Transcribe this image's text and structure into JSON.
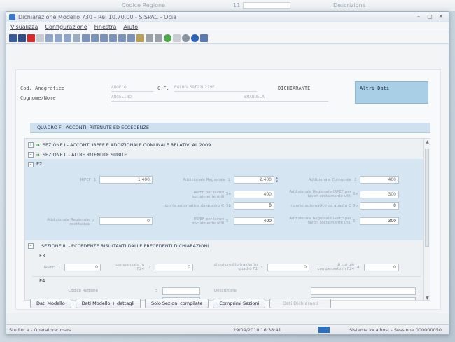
{
  "ghost": {
    "codice_regione": "Codice Regione",
    "num": "11",
    "descrizione": "Descrizione"
  },
  "window": {
    "title": "Dichiarazione Modello 730 - Rel 10.70.00 - SISPAC - Ocia",
    "controls": [
      "–",
      "▢",
      "✕"
    ]
  },
  "menu": [
    "Visualizza",
    "Configurazione",
    "Finestra",
    "Aiuto"
  ],
  "toolbar_icons": [
    "save-icon",
    "delete-icon",
    "new-icon",
    "user-icon",
    "user-icon",
    "user-icon",
    "arrow-icon",
    "grid-icon",
    "grid-icon",
    "grid-icon",
    "grid-icon",
    "grid-icon",
    "grid-icon",
    "sigma-icon",
    "text-icon",
    "settings-icon",
    "green-dot-icon",
    "gray-icon",
    "gear-icon",
    "info-icon",
    "window-icon"
  ],
  "anagrafica": {
    "cod_label": "Cod. Anagrafico",
    "cod_value": "ANGELO",
    "cf_label": "C.F.",
    "cf_value": "RGLNGL59T23L219E",
    "dichiarante": "DICHIARANTE",
    "cognome_label": "Cognome/Nome",
    "cognome_value": "ANGELINO",
    "nome_value": "EMANUELA",
    "altri_dati": "Altri Dati"
  },
  "quadro_title": "QUADRO F - ACCONTI, RITENUTE ED ECCEDENZE",
  "sections": {
    "s1": {
      "toggle": "+",
      "label": "SEZIONE I - ACCONTI IRPEF E ADDIZIONALE COMUNALE RELATIVI AL 2009"
    },
    "s2": {
      "toggle": "–",
      "label": "SEZIONE II - ALTRE RITENUTE SUBITE"
    },
    "s3": {
      "toggle": "–",
      "label": "SEZIONE III - ECCEDENZE RISULTANTI DALLE PRECEDENTI DICHIARAZIONI"
    }
  },
  "f2": {
    "header": "F2",
    "irpef_label": "IRPEF",
    "irpef_num": "1",
    "irpef_val": "1.400",
    "addreg_label": "Addizionale Regionale",
    "addreg_num": "2",
    "addreg_val": "2.400",
    "addcom_label": "Addizionale Comunale",
    "addcom_num": "3",
    "addcom_val": "400",
    "irpef_lav_label": "IRPEF per lavori socialmente utili",
    "irpef_lav_num": "5a",
    "irpef_lav_val": "400",
    "addreg_lav_label": "Addizionale Regionale IRPEF per lavori socialmente utili",
    "addreg_lav_num": "6a",
    "addreg_lav_val": "300",
    "rip_c_label": "riporto automatico da quadro C",
    "rip_c_num": "5b",
    "rip_c_val": "0",
    "rip_c2_label": "riporto automatico da quadro C",
    "rip_c2_num": "6b",
    "rip_c2_val": "0",
    "addreg_ded_label": "Addizionale Regionale sostitutiva",
    "addreg_ded_num": "4",
    "addreg_ded_val": "0",
    "irpef_lav2_label": "IRPEF per lavori socialmente utili",
    "irpef_lav2_num": "5",
    "irpef_lav2_val": "400",
    "addreg_lav2_label": "Addizionale Regionale IRPEF per lavori socialmente utili",
    "addreg_lav2_num": "6",
    "addreg_lav2_val": "300"
  },
  "f3": {
    "header": "F3",
    "irpef_label": "IRPEF",
    "irpef_num": "1",
    "irpef_val": "0",
    "comp_label": "compensato in F24",
    "comp_num": "2",
    "comp_val": "0",
    "credito_label": "di cui credito trasferito quadro F1",
    "credito_num": "3",
    "credito_val": "0",
    "ici_label": "di cui già compensato in F24",
    "ici_num": "4",
    "ici_val": "0"
  },
  "f4": {
    "header": "F4",
    "codice_label": "Codice Regione",
    "codice_num": "5",
    "descr_label": "Descrizione"
  },
  "buttons": [
    "Dati Modello",
    "Dati Modello + dettagli",
    "Solo Sezioni compilate",
    "Comprimi Sezioni",
    "Dati Dichiaranti"
  ],
  "status": {
    "left": "Studio: a - Operatore: mara",
    "datetime": "29/09/2010  16:38:41",
    "right": "Sistema localhost - Sessione 000000050"
  }
}
